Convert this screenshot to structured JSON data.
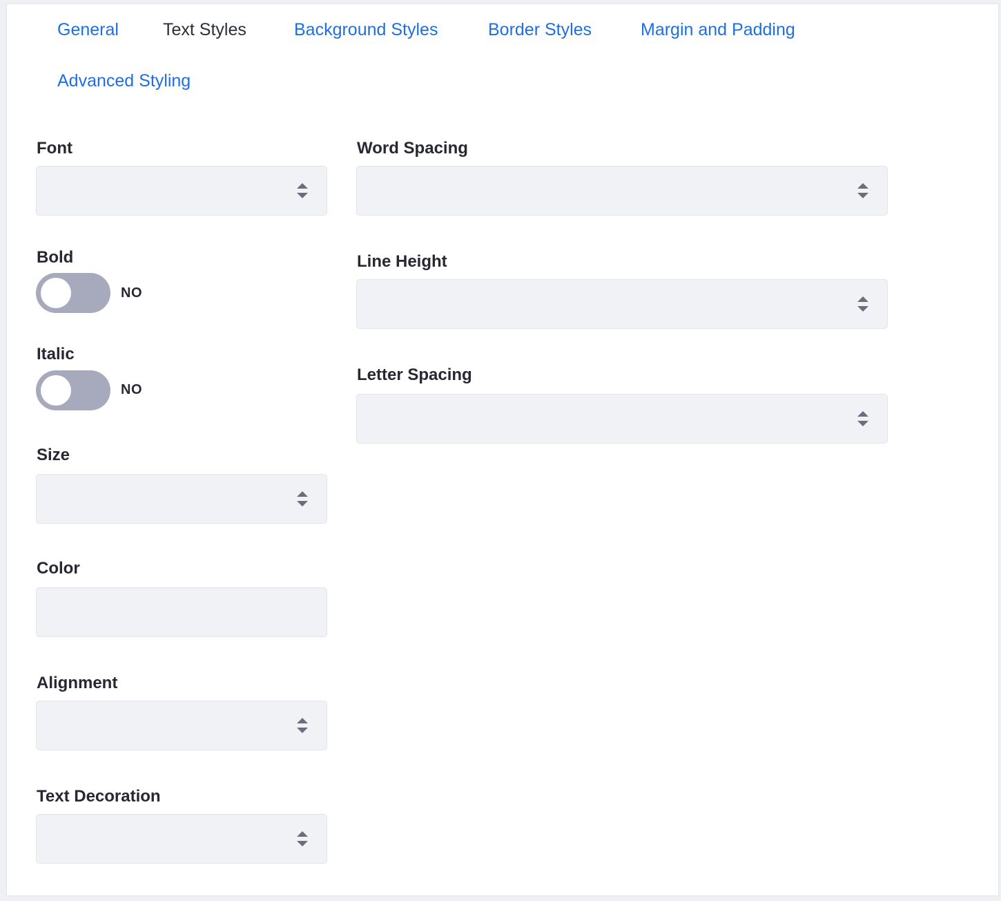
{
  "tabs": [
    {
      "label": "General",
      "active": false
    },
    {
      "label": "Text Styles",
      "active": true
    },
    {
      "label": "Background Styles",
      "active": false
    },
    {
      "label": "Border Styles",
      "active": false
    },
    {
      "label": "Margin and Padding",
      "active": false
    },
    {
      "label": "Advanced Styling",
      "active": false
    }
  ],
  "fields": {
    "font": {
      "label": "Font",
      "value": ""
    },
    "bold": {
      "label": "Bold",
      "state": "NO",
      "on": false
    },
    "italic": {
      "label": "Italic",
      "state": "NO",
      "on": false
    },
    "size": {
      "label": "Size",
      "value": ""
    },
    "color": {
      "label": "Color",
      "value": ""
    },
    "alignment": {
      "label": "Alignment",
      "value": ""
    },
    "text_decoration": {
      "label": "Text Decoration",
      "value": ""
    },
    "word_spacing": {
      "label": "Word Spacing",
      "value": ""
    },
    "line_height": {
      "label": "Line Height",
      "value": ""
    },
    "letter_spacing": {
      "label": "Letter Spacing",
      "value": ""
    }
  },
  "colors": {
    "link": "#1f6fe0",
    "toggle_off": "#a7a9bc",
    "input_bg": "#f1f2f5"
  },
  "icons": {
    "select_arrow": "sort-arrows-icon"
  }
}
